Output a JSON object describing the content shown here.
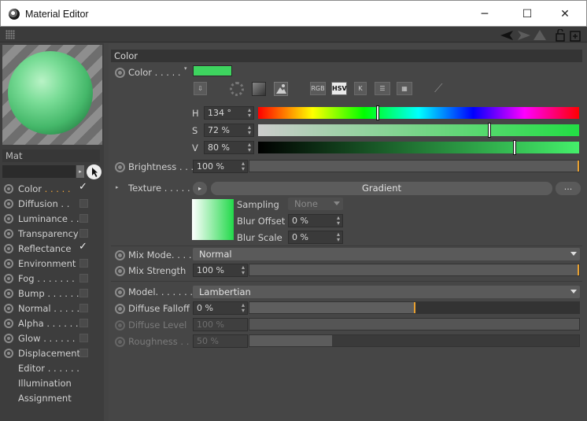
{
  "window": {
    "title": "Material Editor",
    "minimize": "─",
    "maximize": "☐",
    "close": "✕"
  },
  "left": {
    "mat_name": "Mat",
    "channels": [
      {
        "label": "Color",
        "dots": " . . . . .",
        "checked": true,
        "active": true
      },
      {
        "label": "Diffusion",
        "dots": " . .",
        "checked": false
      },
      {
        "label": "Luminance",
        "dots": " . .",
        "checked": false
      },
      {
        "label": "Transparency",
        "dots": "",
        "checked": false
      },
      {
        "label": "Reflectance",
        "dots": "",
        "checked": true
      },
      {
        "label": "Environment",
        "dots": "",
        "checked": false
      },
      {
        "label": "Fog",
        "dots": " . . . . . . .",
        "checked": false
      },
      {
        "label": "Bump",
        "dots": " . . . . . .",
        "checked": false
      },
      {
        "label": "Normal",
        "dots": " . . . . .",
        "checked": false
      },
      {
        "label": "Alpha",
        "dots": " . . . . . .",
        "checked": false
      },
      {
        "label": "Glow",
        "dots": " . . . . . .",
        "checked": false
      },
      {
        "label": "Displacement",
        "dots": "",
        "checked": false
      },
      {
        "label": "Editor",
        "dots": " . . . . . .",
        "noradio": true
      },
      {
        "label": "Illumination",
        "dots": "",
        "noradio": true
      },
      {
        "label": "Assignment",
        "dots": "",
        "noradio": true
      }
    ]
  },
  "section_title": "Color",
  "color": {
    "label": "Color . . . . .",
    "swatch": "#3ed45f",
    "mode_buttons": [
      "RGB",
      "HSV",
      "K"
    ],
    "h": {
      "label": "H",
      "value": "134 °",
      "fraction": 0.372
    },
    "s": {
      "label": "S",
      "value": "72 %",
      "fraction": 0.72
    },
    "v": {
      "label": "V",
      "value": "80 %",
      "fraction": 0.8
    }
  },
  "brightness": {
    "label": "Brightness . . .",
    "value": "100 %",
    "fraction": 1.0
  },
  "texture": {
    "label": "Texture . . . . . .",
    "button": "Gradient",
    "more": "...",
    "sampling_label": "Sampling",
    "sampling_value": "None",
    "blur_offset_label": "Blur Offset",
    "blur_offset_value": "0 %",
    "blur_scale_label": "Blur Scale",
    "blur_scale_value": "0 %"
  },
  "mix_mode": {
    "label": "Mix Mode. . . . . .",
    "value": "Normal"
  },
  "mix_strength": {
    "label": "Mix Strength",
    "value": "100 %",
    "fraction": 1.0
  },
  "model": {
    "label": "Model. . . . . . .",
    "value": "Lambertian"
  },
  "diffuse_falloff": {
    "label": "Diffuse Falloff",
    "value": "0 %",
    "fraction": 0.5
  },
  "diffuse_level": {
    "label": "Diffuse Level",
    "value": "100 %",
    "fraction": 1.0
  },
  "roughness": {
    "label": "Roughness . .",
    "value": "50 %",
    "fraction": 0.25
  }
}
